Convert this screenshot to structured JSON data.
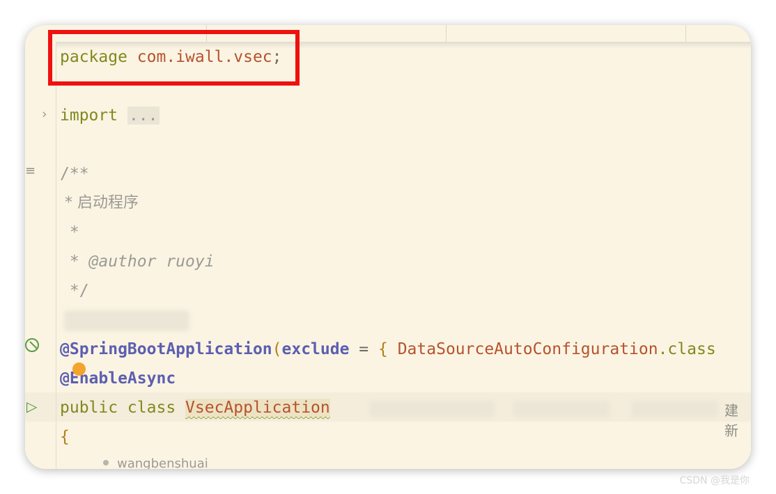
{
  "editor": {
    "package_keyword": "package",
    "package_name": "com.iwall.vsec",
    "package_semicolon": ";",
    "import_keyword": "import",
    "import_fold": "...",
    "doc_open": "/**",
    "doc_line1": " * 启动程序",
    "doc_line2": " *",
    "doc_line3_prefix": " * ",
    "doc_line3_tag": "@author ruoyi",
    "doc_close": " */",
    "annotation1": "@SpringBootApplication",
    "annotation1_paren": "(",
    "annotation1_param": "exclude",
    "annotation1_eq": " = ",
    "annotation1_brace": "{",
    "annotation1_class": "DataSourceAutoConfiguration",
    "annotation1_dot_class": ".class",
    "annotation2": "@EnableAsync",
    "class_modifiers": "public class",
    "class_name": "VsecApplication",
    "open_brace": "{",
    "inline_hint": "建新",
    "author_hint": "wangbenshuai"
  },
  "watermark": "CSDN @我是你",
  "icons": {
    "fold": "chevron-right-icon",
    "doc": "doc-comment-icon",
    "spring": "spring-bean-icon",
    "run": "run-icon",
    "bulb": "intention-dot-icon"
  },
  "colors": {
    "background": "#fbf4e3",
    "highlight_box": "#ef1010",
    "keyword": "#80891f",
    "annotation": "#5c5fb0",
    "class": "#b5532e"
  }
}
